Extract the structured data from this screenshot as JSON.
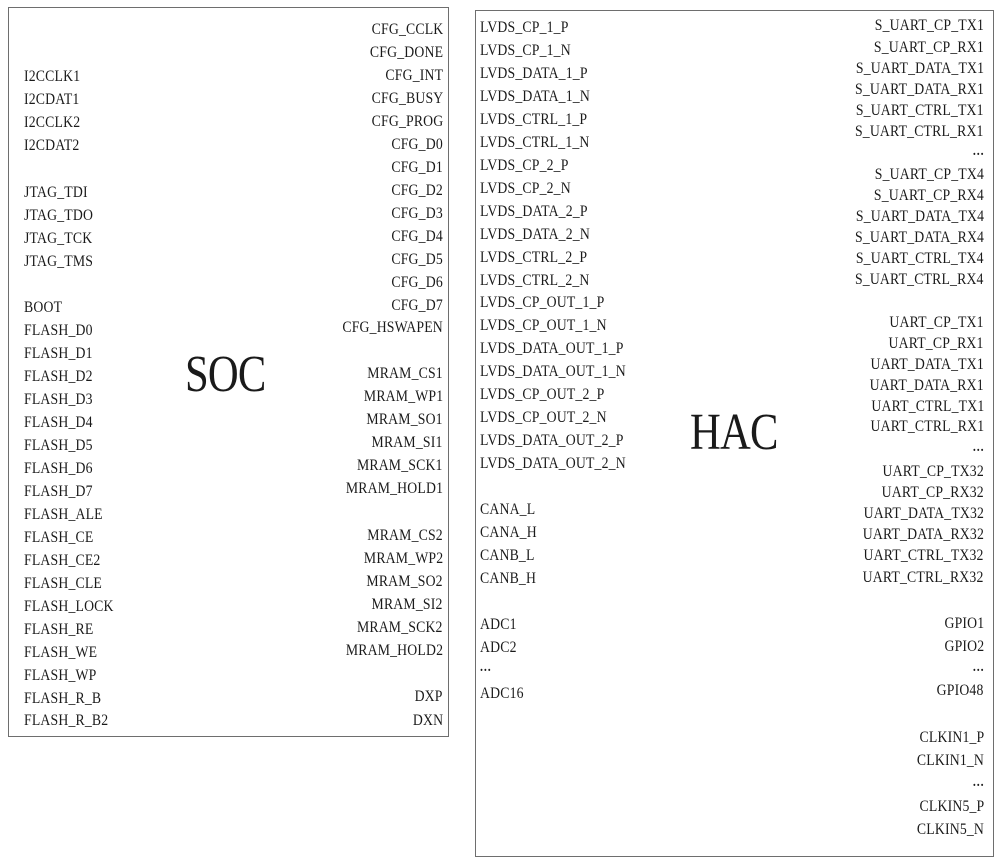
{
  "soc": {
    "title": "SOC",
    "left_pins": [
      {
        "label": "I2CCLK1",
        "row": 77
      },
      {
        "label": "I2CDAT1",
        "row": 100
      },
      {
        "label": "I2CCLK2",
        "row": 123
      },
      {
        "label": "I2CDAT2",
        "row": 146
      },
      {
        "label": "JTAG_TDI",
        "row": 193
      },
      {
        "label": "JTAG_TDO",
        "row": 216
      },
      {
        "label": "JTAG_TCK",
        "row": 239
      },
      {
        "label": "JTAG_TMS",
        "row": 262
      },
      {
        "label": "BOOT",
        "row": 308
      },
      {
        "label": "FLASH_D0",
        "row": 331
      },
      {
        "label": "FLASH_D1",
        "row": 354
      },
      {
        "label": "FLASH_D2",
        "row": 377
      },
      {
        "label": "FLASH_D3",
        "row": 400
      },
      {
        "label": "FLASH_D4",
        "row": 423
      },
      {
        "label": "FLASH_D5",
        "row": 446
      },
      {
        "label": "FLASH_D6",
        "row": 469
      },
      {
        "label": "FLASH_D7",
        "row": 492
      },
      {
        "label": "FLASH_ALE",
        "row": 515
      },
      {
        "label": "FLASH_CE",
        "row": 538
      },
      {
        "label": "FLASH_CE2",
        "row": 561
      },
      {
        "label": "FLASH_CLE",
        "row": 584
      },
      {
        "label": "FLASH_LOCK",
        "row": 607
      },
      {
        "label": "FLASH_RE",
        "row": 630
      },
      {
        "label": "FLASH_WE",
        "row": 653
      },
      {
        "label": "FLASH_WP",
        "row": 676
      },
      {
        "label": "FLASH_R_B",
        "row": 699
      },
      {
        "label": "FLASH_R_B2",
        "row": 721
      }
    ],
    "right_pins": [
      {
        "label": "CFG_CCLK",
        "row": 30
      },
      {
        "label": "CFG_DONE",
        "row": 53
      },
      {
        "label": "CFG_INT",
        "row": 76
      },
      {
        "label": "CFG_BUSY",
        "row": 99
      },
      {
        "label": "CFG_PROG",
        "row": 122
      },
      {
        "label": "CFG_D0",
        "row": 145
      },
      {
        "label": "CFG_D1",
        "row": 168
      },
      {
        "label": "CFG_D2",
        "row": 191
      },
      {
        "label": "CFG_D3",
        "row": 214
      },
      {
        "label": "CFG_D4",
        "row": 237
      },
      {
        "label": "CFG_D5",
        "row": 260
      },
      {
        "label": "CFG_D6",
        "row": 283
      },
      {
        "label": "CFG_D7",
        "row": 306
      },
      {
        "label": "CFG_HSWAPEN",
        "row": 328
      },
      {
        "label": "MRAM_CS1",
        "row": 374
      },
      {
        "label": "MRAM_WP1",
        "row": 397
      },
      {
        "label": "MRAM_SO1",
        "row": 420
      },
      {
        "label": "MRAM_SI1",
        "row": 443
      },
      {
        "label": "MRAM_SCK1",
        "row": 466
      },
      {
        "label": "MRAM_HOLD1",
        "row": 489
      },
      {
        "label": "MRAM_CS2",
        "row": 536
      },
      {
        "label": "MRAM_WP2",
        "row": 559
      },
      {
        "label": "MRAM_SO2",
        "row": 582
      },
      {
        "label": "MRAM_SI2",
        "row": 605
      },
      {
        "label": "MRAM_SCK2",
        "row": 628
      },
      {
        "label": "MRAM_HOLD2",
        "row": 651
      },
      {
        "label": "DXP",
        "row": 697
      },
      {
        "label": "DXN",
        "row": 721
      }
    ]
  },
  "hac": {
    "title": "HAC",
    "left_pins": [
      {
        "label": "LVDS_CP_1_P",
        "row": 28
      },
      {
        "label": "LVDS_CP_1_N",
        "row": 51
      },
      {
        "label": "LVDS_DATA_1_P",
        "row": 74
      },
      {
        "label": "LVDS_DATA_1_N",
        "row": 97
      },
      {
        "label": "LVDS_CTRL_1_P",
        "row": 120
      },
      {
        "label": "LVDS_CTRL_1_N",
        "row": 143
      },
      {
        "label": "LVDS_CP_2_P",
        "row": 166
      },
      {
        "label": "LVDS_CP_2_N",
        "row": 189
      },
      {
        "label": "LVDS_DATA_2_P",
        "row": 212
      },
      {
        "label": "LVDS_DATA_2_N",
        "row": 235
      },
      {
        "label": "LVDS_CTRL_2_P",
        "row": 258
      },
      {
        "label": "LVDS_CTRL_2_N",
        "row": 281
      },
      {
        "label": "LVDS_CP_OUT_1_P",
        "row": 303
      },
      {
        "label": "LVDS_CP_OUT_1_N",
        "row": 326
      },
      {
        "label": "LVDS_DATA_OUT_1_P",
        "row": 349
      },
      {
        "label": "LVDS_DATA_OUT_1_N",
        "row": 372
      },
      {
        "label": "LVDS_CP_OUT_2_P",
        "row": 395
      },
      {
        "label": "LVDS_CP_OUT_2_N",
        "row": 418
      },
      {
        "label": "LVDS_DATA_OUT_2_P",
        "row": 441
      },
      {
        "label": "LVDS_DATA_OUT_2_N",
        "row": 464
      },
      {
        "label": "CANA_L",
        "row": 510
      },
      {
        "label": "CANA_H",
        "row": 533
      },
      {
        "label": "CANB_L",
        "row": 556
      },
      {
        "label": "CANB_H",
        "row": 579
      },
      {
        "label": "ADC1",
        "row": 625
      },
      {
        "label": "ADC2",
        "row": 648
      },
      {
        "label": "...",
        "row": 668,
        "ellipsis": true
      },
      {
        "label": "ADC16",
        "row": 694
      }
    ],
    "right_pins": [
      {
        "label": "S_UART_CP_TX1",
        "row": 26
      },
      {
        "label": "S_UART_CP_RX1",
        "row": 48
      },
      {
        "label": "S_UART_DATA_TX1",
        "row": 69
      },
      {
        "label": "S_UART_DATA_RX1",
        "row": 90
      },
      {
        "label": "S_UART_CTRL_TX1",
        "row": 111
      },
      {
        "label": "S_UART_CTRL_RX1",
        "row": 132
      },
      {
        "label": "...",
        "row": 152,
        "ellipsis": true
      },
      {
        "label": "S_UART_CP_TX4",
        "row": 175
      },
      {
        "label": "S_UART_CP_RX4",
        "row": 196
      },
      {
        "label": "S_UART_DATA_TX4",
        "row": 217
      },
      {
        "label": "S_UART_DATA_RX4",
        "row": 238
      },
      {
        "label": "S_UART_CTRL_TX4",
        "row": 259
      },
      {
        "label": "S_UART_CTRL_RX4",
        "row": 280
      },
      {
        "label": "UART_CP_TX1",
        "row": 323
      },
      {
        "label": "UART_CP_RX1",
        "row": 344
      },
      {
        "label": "UART_DATA_TX1",
        "row": 365
      },
      {
        "label": "UART_DATA_RX1",
        "row": 386
      },
      {
        "label": "UART_CTRL_TX1",
        "row": 407
      },
      {
        "label": "UART_CTRL_RX1",
        "row": 427
      },
      {
        "label": "...",
        "row": 448,
        "ellipsis": true
      },
      {
        "label": "UART_CP_TX32",
        "row": 472
      },
      {
        "label": "UART_CP_RX32",
        "row": 493
      },
      {
        "label": "UART_DATA_TX32",
        "row": 514
      },
      {
        "label": "UART_DATA_RX32",
        "row": 535
      },
      {
        "label": "UART_CTRL_TX32",
        "row": 556
      },
      {
        "label": "UART_CTRL_RX32",
        "row": 578
      },
      {
        "label": "GPIO1",
        "row": 624
      },
      {
        "label": "GPIO2",
        "row": 647
      },
      {
        "label": "...",
        "row": 668,
        "ellipsis": true
      },
      {
        "label": "GPIO48",
        "row": 691
      },
      {
        "label": "CLKIN1_P",
        "row": 738
      },
      {
        "label": "CLKIN1_N",
        "row": 761
      },
      {
        "label": "...",
        "row": 783,
        "ellipsis": true
      },
      {
        "label": "CLKIN5_P",
        "row": 807
      },
      {
        "label": "CLKIN5_N",
        "row": 830
      }
    ]
  }
}
